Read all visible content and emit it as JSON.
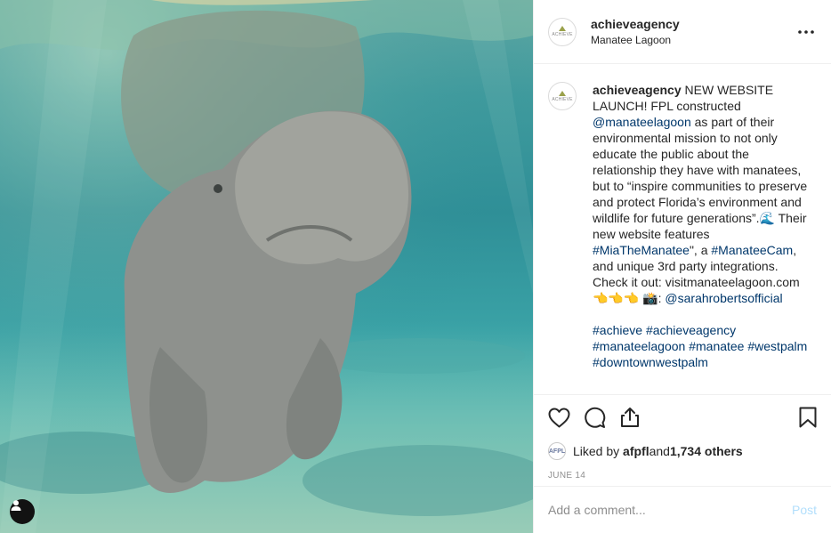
{
  "colors": {
    "link": "#00376b",
    "post_disabled": "#b2dffc",
    "muted": "#8e8e8e"
  },
  "photo": {
    "subject_icon": "user-tag-icon"
  },
  "header": {
    "avatar_text": "ACHIEVE",
    "username": "achieveagency",
    "location": "Manatee Lagoon",
    "more_icon": "more-options-icon"
  },
  "caption": {
    "avatar_text": "ACHIEVE",
    "username": "achieveagency",
    "t1": " NEW WEBSITE LAUNCH! FPL constructed ",
    "m1": "@manateelagoon",
    "t2": " as part of their environmental mission to not only educate the public about the relationship they have with manatees, but to “inspire communities to preserve and protect Florida’s environment and wildlife for future generations”.🌊 Their new website features ",
    "h1": "#MiaTheManatee",
    "t3": "\", a ",
    "h2": "#ManateeCam",
    "t4": ", and unique 3rd party integrations. Check it out: visitmanateelagoon.com 👈👈👈 📸: ",
    "m2": "@sarahrobertsofficial",
    "tags": [
      "#achieve",
      "#achieveagency",
      "#manateelagoon",
      "#manatee",
      "#westpalm",
      "#downtownwestpalm"
    ]
  },
  "actions": {
    "like_icon": "heart-icon",
    "comment_icon": "comment-icon",
    "share_icon": "share-icon",
    "save_icon": "bookmark-icon"
  },
  "likes": {
    "avatar_text": "AFPL",
    "prefix": "Liked by ",
    "user": "afpfl",
    "and": " and ",
    "count": "1,734 others"
  },
  "date": "JUNE 14",
  "comment": {
    "placeholder": "Add a comment...",
    "post_label": "Post"
  }
}
